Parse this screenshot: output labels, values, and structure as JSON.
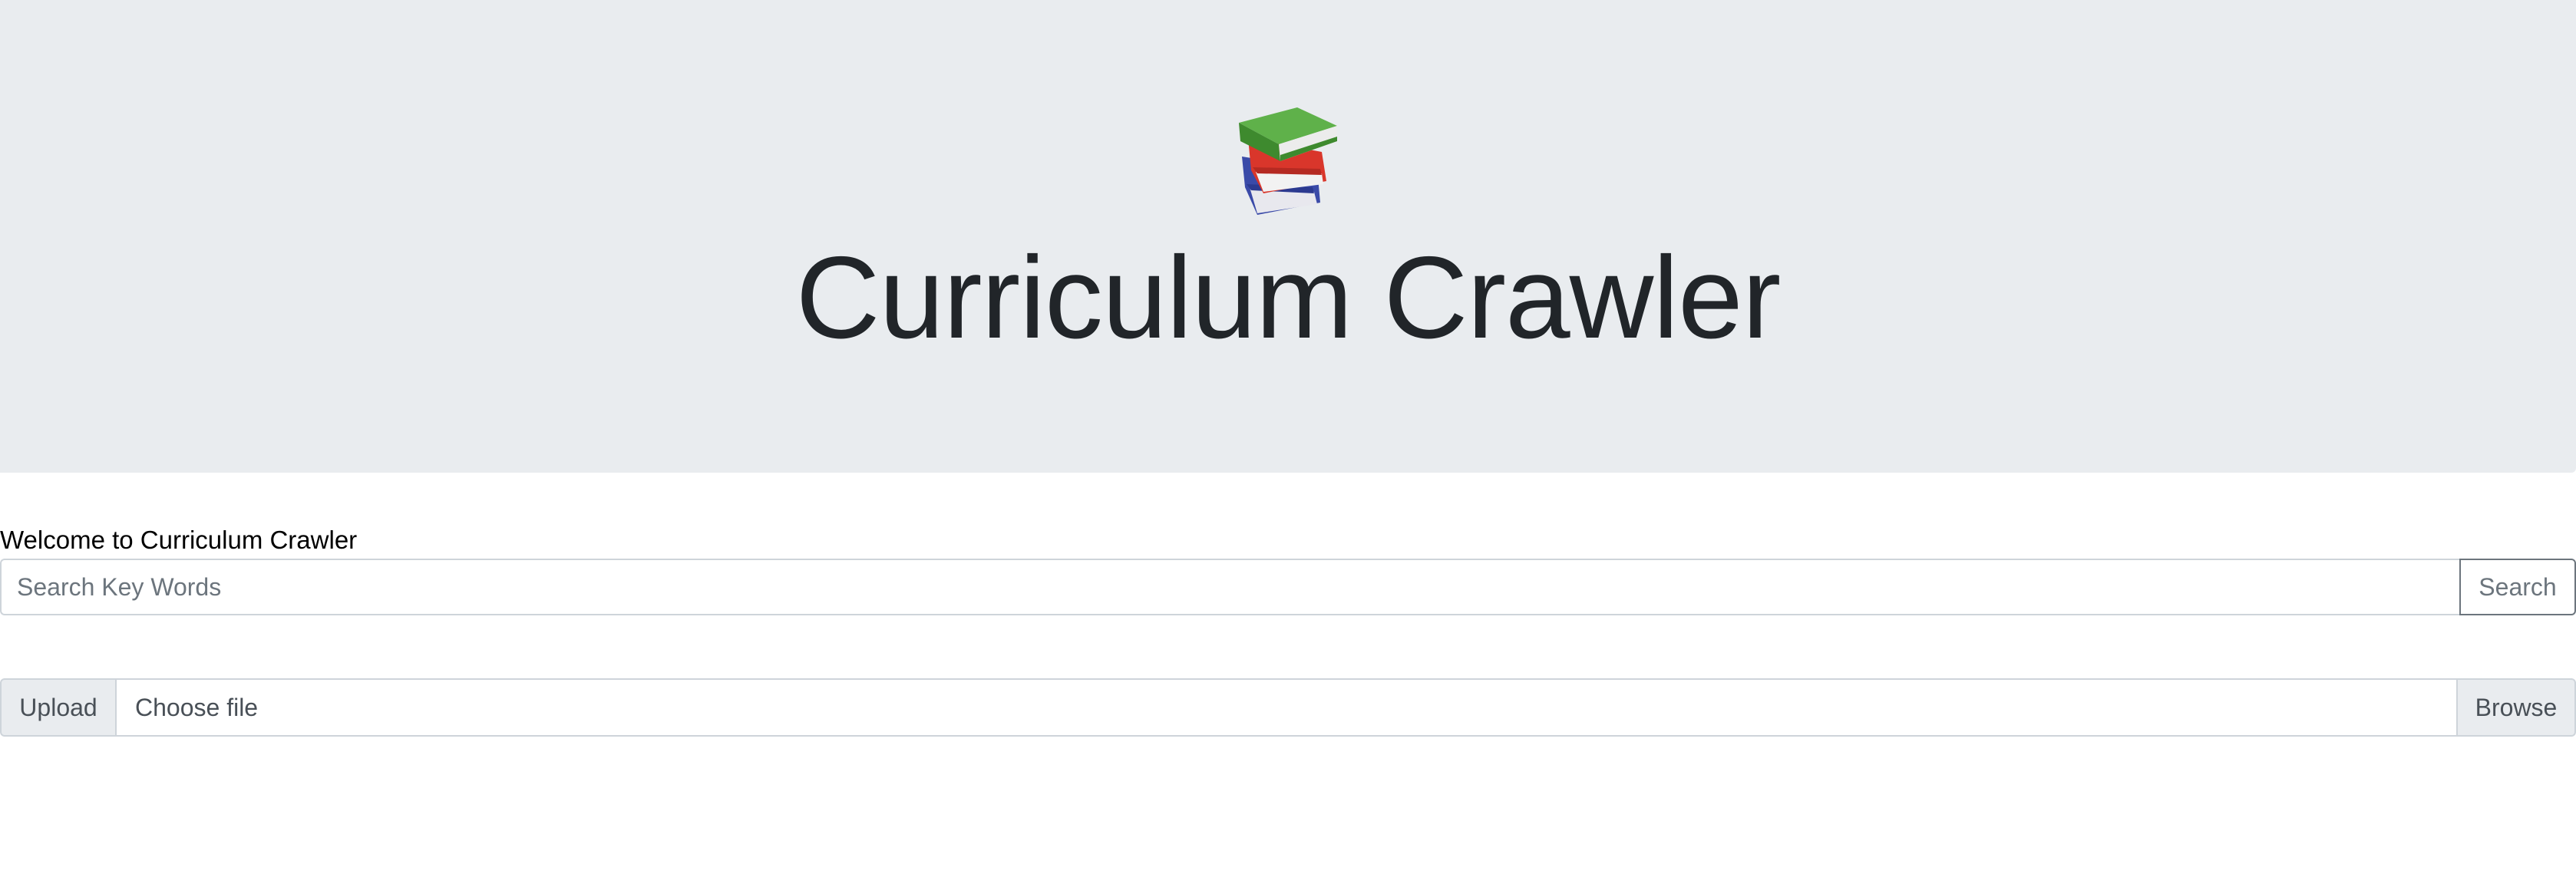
{
  "header": {
    "icon": "books-icon",
    "title": "Curriculum Crawler",
    "background": "#e9ecef"
  },
  "main": {
    "welcome_text": "Welcome to Curriculum Crawler",
    "search": {
      "value": "",
      "placeholder": "Search Key Words",
      "button_label": "Search"
    },
    "upload": {
      "prepend_label": "Upload",
      "file_label": "Choose file",
      "browse_label": "Browse"
    }
  }
}
